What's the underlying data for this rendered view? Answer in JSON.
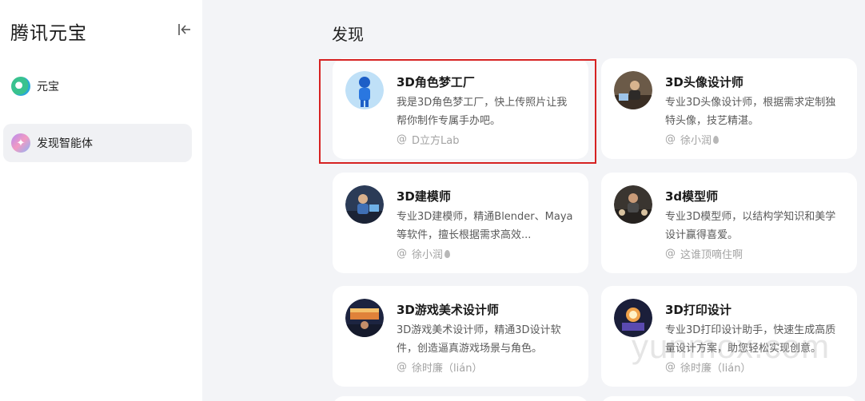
{
  "sidebar": {
    "app_title": "腾讯元宝",
    "items": [
      {
        "label": "元宝",
        "icon": "yuanbao-logo-icon"
      },
      {
        "label": "发现智能体",
        "icon": "sparkle-icon"
      }
    ]
  },
  "main": {
    "title": "发现",
    "cards": [
      {
        "title": "3D角色梦工厂",
        "desc": "我是3D角色梦工厂，快上传照片让我帮你制作专属手办吧。",
        "author": "D立方Lab",
        "avatar": "blue-figurine-avatar"
      },
      {
        "title": "3D头像设计师",
        "desc": "专业3D头像设计师，根据需求定制独特头像，技艺精湛。",
        "author": "徐小润",
        "avatar": "designer-avatar"
      },
      {
        "title": "3D建模师",
        "desc": "专业3D建模师，精通Blender、Maya等软件，擅长根据需求高效...",
        "author": "徐小润",
        "avatar": "modeler-avatar"
      },
      {
        "title": "3d模型师",
        "desc": "专业3D模型师，以结构学知识和美学设计赢得喜爱。",
        "author": "这谁顶嘀住啊",
        "avatar": "model-artist-avatar"
      },
      {
        "title": "3D游戏美术设计师",
        "desc": "3D游戏美术设计师，精通3D设计软件，创造逼真游戏场景与角色。",
        "author": "徐时廉（lián）",
        "avatar": "game-artist-avatar"
      },
      {
        "title": "3D打印设计",
        "desc": "专业3D打印设计助手，快速生成高质量设计方案，助您轻松实现创意。",
        "author": "徐时廉（lián）",
        "avatar": "printer-avatar"
      }
    ]
  },
  "watermark": "yunmox.com",
  "colors": {
    "highlight": "#d62222",
    "background": "#f3f4f7"
  }
}
